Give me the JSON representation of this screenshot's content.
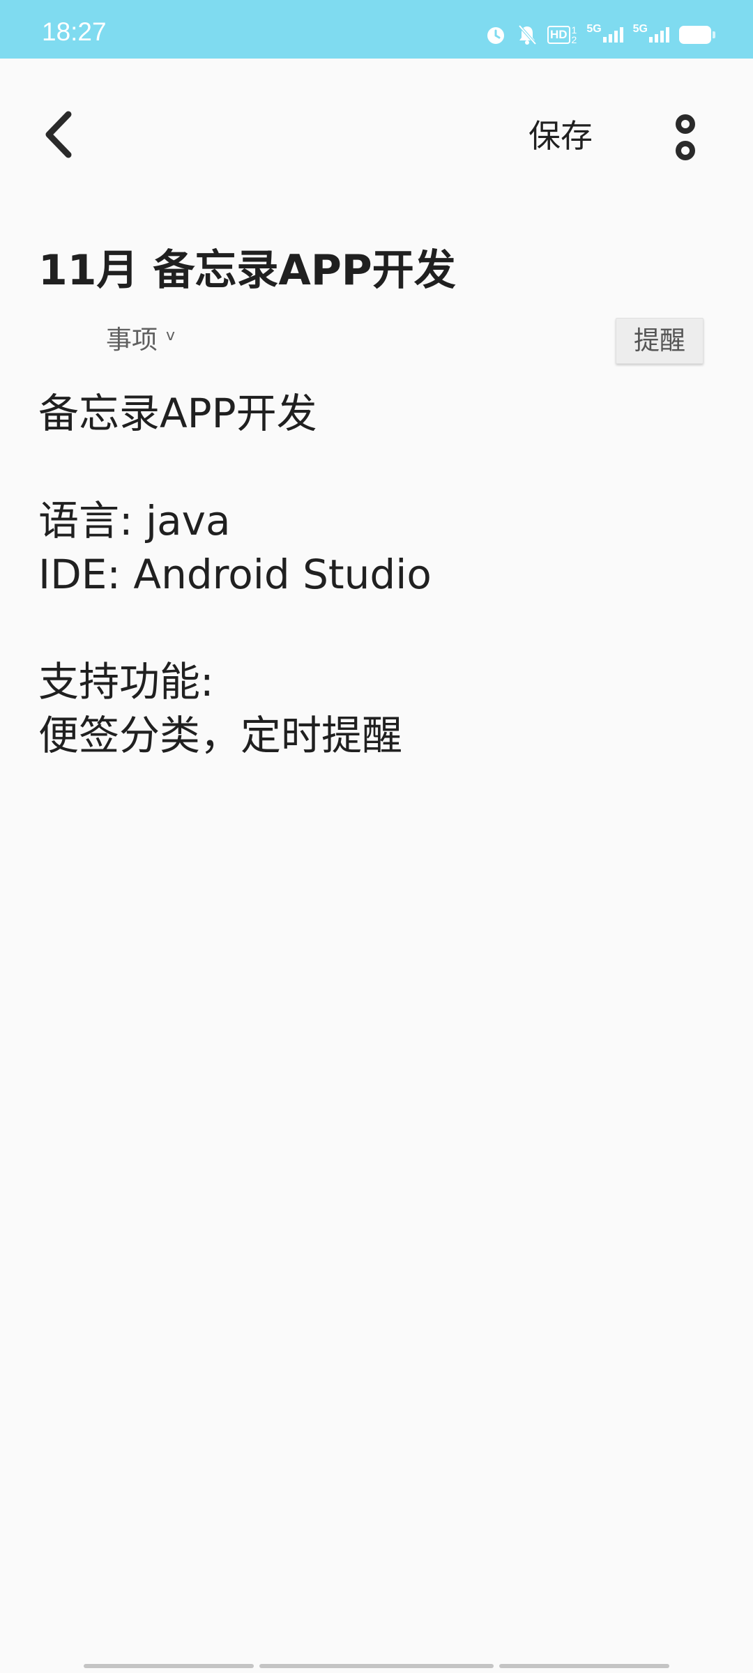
{
  "status_bar": {
    "time": "18:27",
    "icons": [
      "alarm-icon",
      "bell-off-icon",
      "hd-icon",
      "signal-5g-icon",
      "signal-5g-icon",
      "battery-icon"
    ],
    "hd_label": "HD",
    "hd_sub_top": "1",
    "hd_sub_bottom": "2",
    "network_1": "5G",
    "network_2": "5G",
    "background_color": "#7fdbf0"
  },
  "toolbar": {
    "back_icon": "chevron-left-icon",
    "save_label": "保存",
    "more_icon": "more-vertical-icon"
  },
  "note": {
    "title": "11月 备忘录APP开发",
    "category": "事项",
    "category_caret": "v",
    "remind_label": "提醒",
    "body_lines": [
      "备忘录APP开发",
      "",
      "语言: java",
      "IDE: Android Studio",
      "",
      "支持功能:",
      "便签分类，定时提醒"
    ]
  }
}
